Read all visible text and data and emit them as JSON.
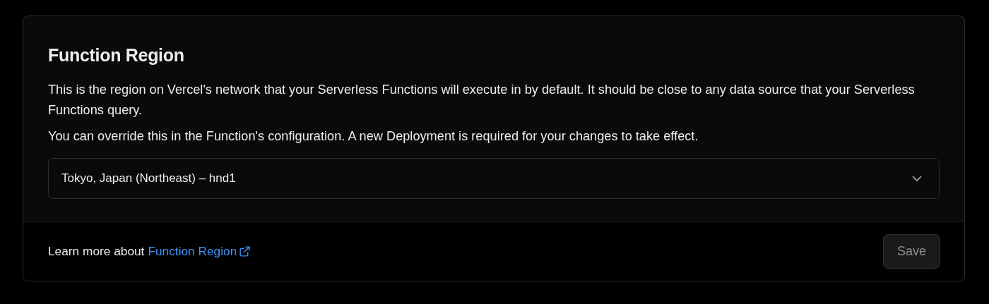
{
  "card": {
    "title": "Function Region",
    "paragraphs": [
      "This is the region on Vercel's network that your Serverless Functions will execute in by default. It should be close to any data source that your Serverless Functions query.",
      "You can override this in the Function's configuration. A new Deployment is required for your changes to take effect."
    ],
    "region_select": {
      "value": "Tokyo, Japan (Northeast) – hnd1"
    },
    "footer": {
      "text": "Learn more about",
      "link": "Function Region",
      "save_button": {
        "label": "Save",
        "disabled": true
      }
    }
  }
}
